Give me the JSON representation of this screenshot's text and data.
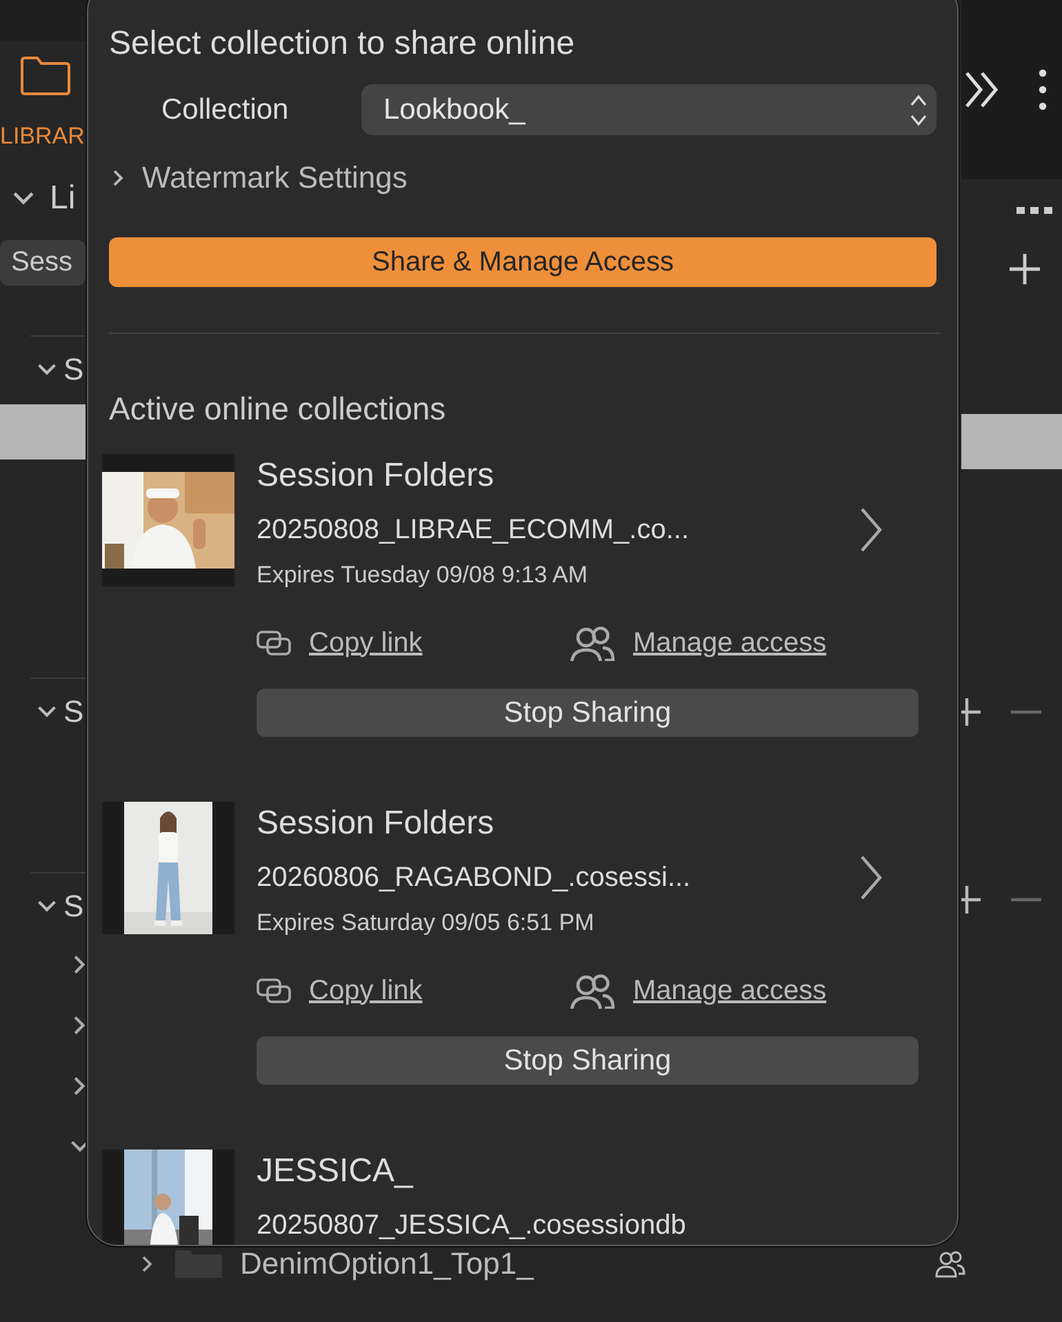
{
  "sidebar": {
    "tab_label": "LIBRAR",
    "library": {
      "label": "Li",
      "expanded": true
    },
    "filter_chip": "Sess",
    "sections": [
      {
        "label": "S",
        "expanded": true,
        "highlighted_row": true
      },
      {
        "label": "S",
        "expanded": true,
        "highlighted_row": false
      },
      {
        "label": "S",
        "expanded": true,
        "highlighted_row": false
      }
    ],
    "tree_rows": [
      {
        "expanded": false
      },
      {
        "expanded": false
      },
      {
        "expanded": false
      },
      {
        "expanded": true
      }
    ],
    "folders": [
      {
        "name": "DenimOption1_Top1_",
        "expanded": false
      }
    ]
  },
  "popup": {
    "title": "Select collection to share online",
    "collection_label": "Collection",
    "collection_value": "Lookbook_",
    "watermark": {
      "label": "Watermark Settings",
      "expanded": false
    },
    "share_button": "Share & Manage Access",
    "section_title": "Active online collections",
    "collections": [
      {
        "kind": "full",
        "title": "Session Folders",
        "file": "20250808_LIBRAE_ECOMM_.co...",
        "expires": "Expires Tuesday  09/08  9:13 AM",
        "copy_link": "Copy link",
        "manage_access": "Manage access",
        "stop_button": "Stop Sharing"
      },
      {
        "kind": "full",
        "title": "Session Folders",
        "file": "20260806_RAGABOND_.cosessi...",
        "expires": "Expires Saturday  09/05  6:51 PM",
        "copy_link": "Copy link",
        "manage_access": "Manage access",
        "stop_button": "Stop Sharing"
      },
      {
        "kind": "partial",
        "title": "JESSICA_",
        "file": "20250807_JESSICA_.cosessiondb"
      }
    ]
  }
}
